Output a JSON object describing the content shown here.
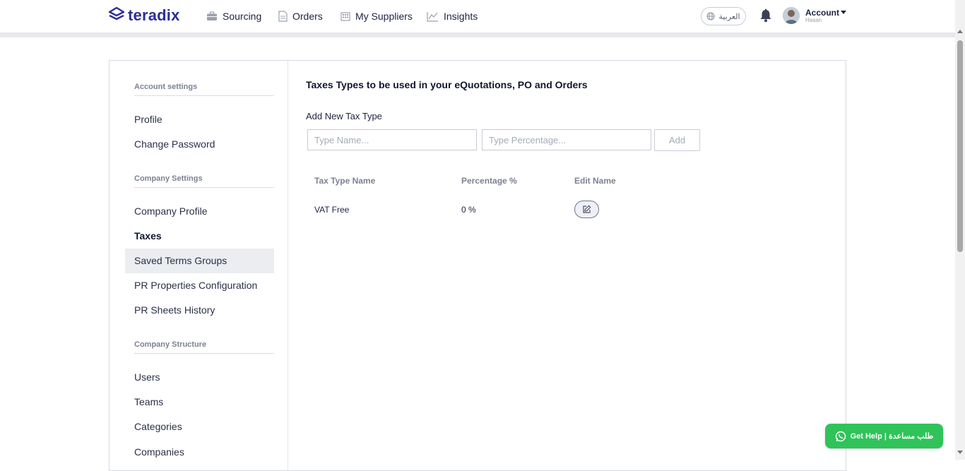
{
  "brand": {
    "name": "teradix"
  },
  "nav": {
    "items": [
      {
        "label": "Sourcing",
        "icon": "briefcase-icon"
      },
      {
        "label": "Orders",
        "icon": "document-icon"
      },
      {
        "label": "My Suppliers",
        "icon": "building-icon"
      },
      {
        "label": "Insights",
        "icon": "chart-line-icon"
      }
    ],
    "language_label": "العربية",
    "account_label": "Account",
    "account_user": "Hasan"
  },
  "sidebar": {
    "sections": [
      {
        "title": "Account settings",
        "items": [
          "Profile",
          "Change Password"
        ]
      },
      {
        "title": "Company Settings",
        "items": [
          "Company Profile",
          "Taxes",
          "Saved Terms Groups",
          "PR Properties Configuration",
          "PR Sheets History"
        ]
      },
      {
        "title": "Company Structure",
        "items": [
          "Users",
          "Teams",
          "Categories",
          "Companies"
        ]
      }
    ],
    "active_item": "Taxes",
    "hovered_item": "Saved Terms Groups"
  },
  "main": {
    "title": "Taxes Types to be used in your eQuotations, PO and Orders",
    "add_label": "Add New Tax Type",
    "name_placeholder": "Type Name...",
    "percentage_placeholder": "Type Percentage...",
    "add_button": "Add",
    "table": {
      "headers": [
        "Tax Type Name",
        "Percentage %",
        "Edit Name"
      ],
      "rows": [
        {
          "name": "VAT Free",
          "percentage": "0 %"
        }
      ]
    }
  },
  "help_button": "Get Help | طلب مساعدة",
  "colors": {
    "brand": "#2c2f9a",
    "help_green": "#2fc35a",
    "hover_bg": "#ecedf1"
  }
}
